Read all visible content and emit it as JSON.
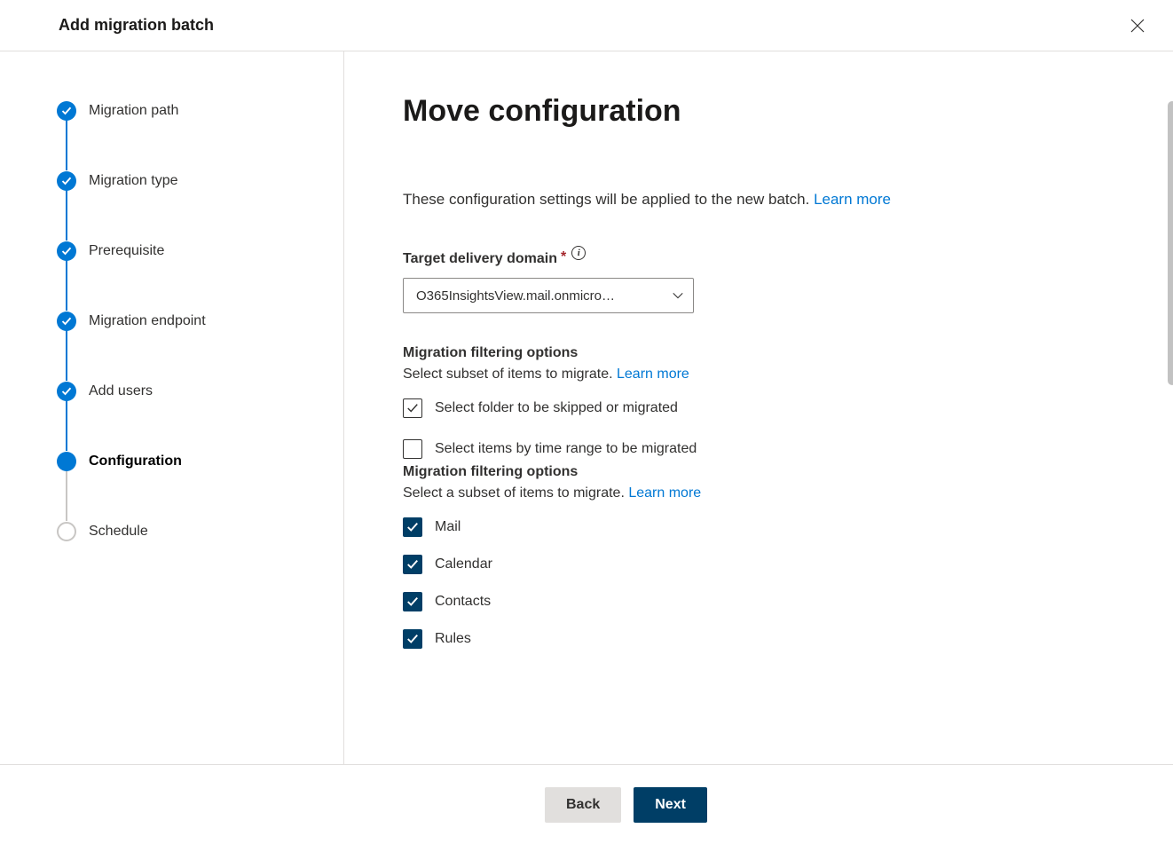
{
  "header": {
    "title": "Add migration batch"
  },
  "sidebar": {
    "steps": [
      {
        "label": "Migration path",
        "state": "done"
      },
      {
        "label": "Migration type",
        "state": "done"
      },
      {
        "label": "Prerequisite",
        "state": "done"
      },
      {
        "label": "Migration endpoint",
        "state": "done"
      },
      {
        "label": "Add users",
        "state": "done"
      },
      {
        "label": "Configuration",
        "state": "current"
      },
      {
        "label": "Schedule",
        "state": "pending"
      }
    ]
  },
  "main": {
    "heading": "Move configuration",
    "intro_text": "These configuration settings will be applied to the new batch. ",
    "learn_more": "Learn more",
    "target_domain_label": "Target delivery domain",
    "target_domain_value": "O365InsightsView.mail.onmicro…",
    "filter1_title": "Migration filtering options",
    "filter1_sub": "Select subset of items to migrate. ",
    "cb_folder": "Select folder to be skipped or migrated",
    "cb_timerange": "Select items by time range to be migrated",
    "filter2_title": "Migration filtering options",
    "filter2_sub": "Select a subset of items to migrate. ",
    "cb_mail": "Mail",
    "cb_calendar": "Calendar",
    "cb_contacts": "Contacts",
    "cb_rules": "Rules"
  },
  "footer": {
    "back": "Back",
    "next": "Next"
  }
}
